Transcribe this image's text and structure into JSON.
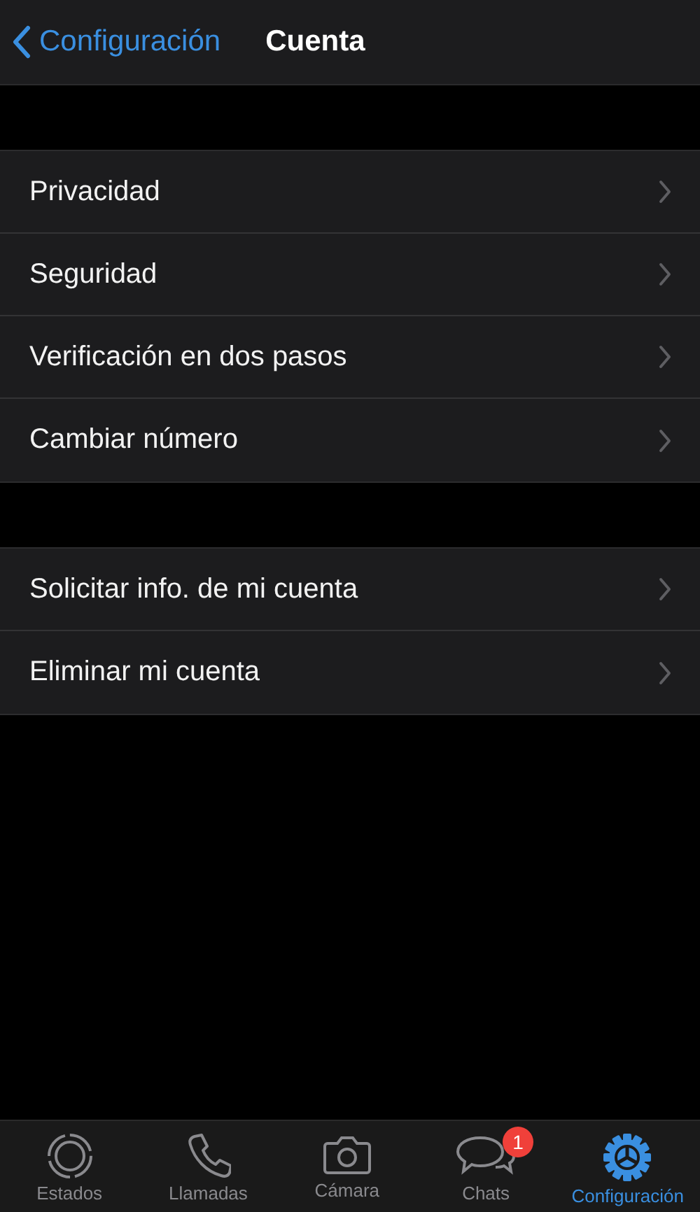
{
  "nav": {
    "back": "Configuración",
    "title": "Cuenta"
  },
  "sections": [
    {
      "items": [
        {
          "label": "Privacidad"
        },
        {
          "label": "Seguridad"
        },
        {
          "label": "Verificación en dos pasos"
        },
        {
          "label": "Cambiar número"
        }
      ]
    },
    {
      "items": [
        {
          "label": "Solicitar info. de mi cuenta"
        },
        {
          "label": "Eliminar mi cuenta"
        }
      ]
    }
  ],
  "tab_bar": [
    {
      "kind": "status",
      "label": "Estados",
      "selected": false
    },
    {
      "kind": "calls",
      "label": "Llamadas",
      "selected": false
    },
    {
      "kind": "camera",
      "label": "Cámara",
      "selected": false
    },
    {
      "kind": "chats",
      "label": "Chats",
      "selected": false,
      "badge": "1"
    },
    {
      "kind": "settings",
      "label": "Configuración",
      "selected": true
    }
  ]
}
